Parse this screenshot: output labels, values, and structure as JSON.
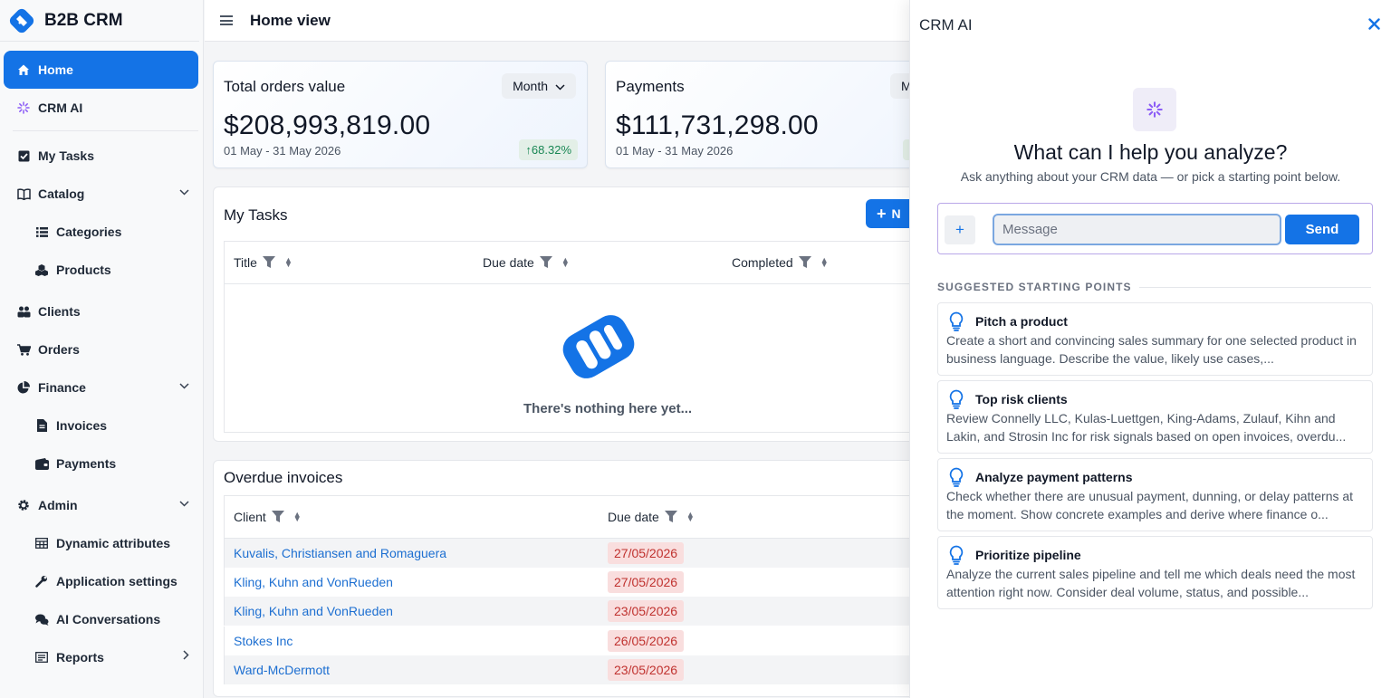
{
  "app": {
    "name": "B2B CRM"
  },
  "sidebar": {
    "items": [
      {
        "label": "Home",
        "icon": "home-icon"
      },
      {
        "label": "CRM AI",
        "icon": "sparkle-icon"
      },
      {
        "label": "My Tasks",
        "icon": "checkbox-icon"
      },
      {
        "label": "Catalog",
        "icon": "book-icon"
      },
      {
        "label": "Categories",
        "icon": "list-icon"
      },
      {
        "label": "Products",
        "icon": "boxes-icon"
      },
      {
        "label": "Clients",
        "icon": "people-icon"
      },
      {
        "label": "Orders",
        "icon": "cart-icon"
      },
      {
        "label": "Finance",
        "icon": "pie-icon"
      },
      {
        "label": "Invoices",
        "icon": "file-icon"
      },
      {
        "label": "Payments",
        "icon": "wallet-icon"
      },
      {
        "label": "Admin",
        "icon": "gear-icon"
      },
      {
        "label": "Dynamic attributes",
        "icon": "table-icon"
      },
      {
        "label": "Application settings",
        "icon": "wrench-icon"
      },
      {
        "label": "AI Conversations",
        "icon": "chat-icon"
      },
      {
        "label": "Reports",
        "icon": "report-icon"
      }
    ]
  },
  "header": {
    "title": "Home view"
  },
  "kpis": [
    {
      "title": "Total orders value",
      "period": "Month",
      "value": "$208,993,819.00",
      "range": "01 May - 31 May 2026",
      "change": "↑68.32%"
    },
    {
      "title": "Payments",
      "period": "M",
      "value": "$111,731,298.00",
      "range": "01 May - 31 May 2026"
    }
  ],
  "tasks": {
    "title": "My Tasks",
    "new_label": "N",
    "columns": [
      "Title",
      "Due date",
      "Completed"
    ],
    "empty_text": "There's nothing here yet..."
  },
  "overdue": {
    "title": "Overdue invoices",
    "columns": [
      "Client",
      "Due date"
    ],
    "rows": [
      {
        "client": "Kuvalis, Christiansen and Romaguera",
        "due": "27/05/2026"
      },
      {
        "client": "Kling, Kuhn and VonRueden",
        "due": "27/05/2026"
      },
      {
        "client": "Kling, Kuhn and VonRueden",
        "due": "23/05/2026"
      },
      {
        "client": "Stokes Inc",
        "due": "26/05/2026"
      },
      {
        "client": "Ward-McDermott",
        "due": "23/05/2026"
      }
    ]
  },
  "ai": {
    "title": "CRM AI",
    "heading": "What can I help you analyze?",
    "subheading": "Ask anything about your CRM data — or pick a starting point below.",
    "input_placeholder": "Message",
    "send_label": "Send",
    "plus_label": "+",
    "suggestions_label": "SUGGESTED STARTING POINTS",
    "suggestions": [
      {
        "title": "Pitch a product",
        "desc": "Create a short and convincing sales summary for one selected product in business language. Describe the value, likely use cases,..."
      },
      {
        "title": "Top risk clients",
        "desc": "Review Connelly LLC, Kulas-Luettgen, King-Adams, Zulauf, Kihn and Lakin, and Strosin Inc for risk signals based on open invoices, overdu..."
      },
      {
        "title": "Analyze payment patterns",
        "desc": "Check whether there are unusual payment, dunning, or delay patterns at the moment. Show concrete examples and derive where finance o..."
      },
      {
        "title": "Prioritize pipeline",
        "desc": "Analyze the current sales pipeline and tell me which deals need the most attention right now. Consider deal volume, status, and possible..."
      }
    ]
  },
  "colors": {
    "accent": "#1473e6",
    "danger": "#c0322f",
    "success": "#198754",
    "ai_border": "#b9a7e8"
  }
}
